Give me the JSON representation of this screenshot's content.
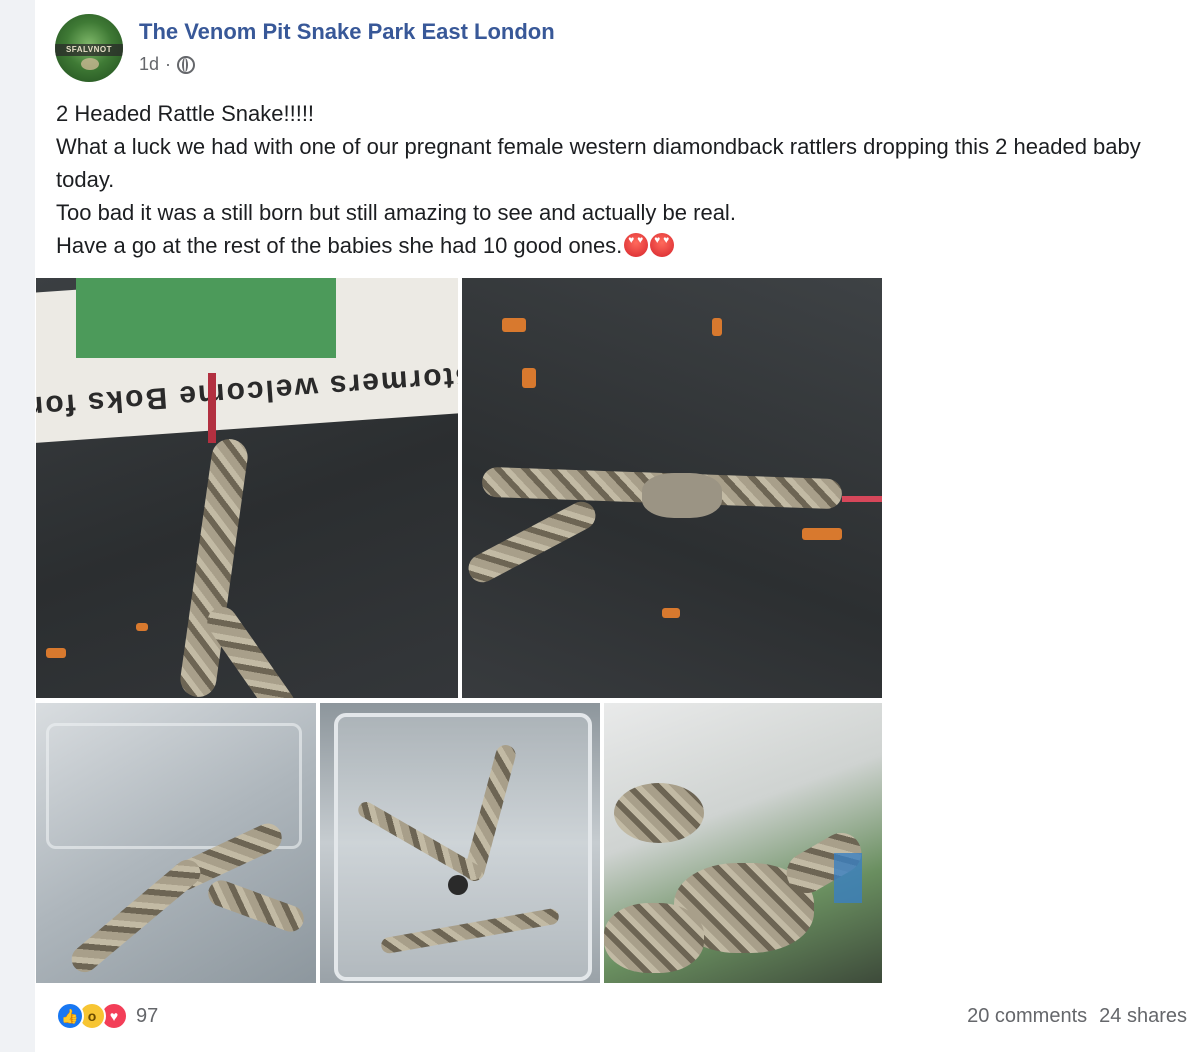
{
  "post": {
    "page_name": "The Venom Pit Snake Park East London",
    "avatar_text": "SFALVNOT",
    "timestamp": "1d",
    "separator": "·",
    "audience_icon": "globe-icon",
    "text_lines": [
      "2 Headed Rattle Snake!!!!!",
      "What a luck we had with one of our pregnant female western diamondback rattlers dropping this 2 headed baby today.",
      "Too bad it was a still born but still amazing to see and actually be real.",
      "Have a go at the rest of the babies she had 10 good ones."
    ],
    "emojis": [
      "heart-eyes-emoji",
      "heart-eyes-emoji"
    ],
    "photo_newspaper_text": "Stormers welcome Boks for Clermont"
  },
  "footer": {
    "reaction_icons": [
      "like-icon",
      "wow-icon",
      "love-icon"
    ],
    "reaction_count": "97",
    "comments": "20 comments",
    "shares": "24 shares"
  },
  "colors": {
    "page_name": "#385898",
    "meta": "#65676b",
    "text": "#1c1e21",
    "background": "#f0f2f5",
    "card": "#ffffff"
  }
}
